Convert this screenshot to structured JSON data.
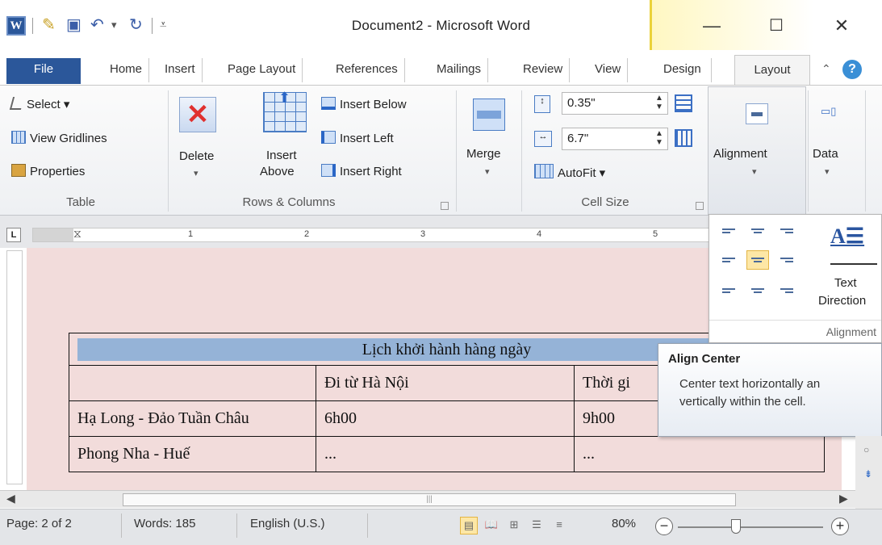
{
  "titlebar": {
    "app_icon_letter": "W",
    "title": "Document2 - Microsoft Word",
    "minimize": "—",
    "maximize": "☐",
    "close": "✕"
  },
  "tabs": {
    "file": "File",
    "home": "Home",
    "insert": "Insert",
    "page_layout": "Page Layout",
    "references": "References",
    "mailings": "Mailings",
    "review": "Review",
    "view": "View",
    "design": "Design",
    "layout": "Layout",
    "help": "?"
  },
  "ribbon": {
    "table_group": {
      "select": "Select ▾",
      "view_gridlines": "View Gridlines",
      "properties": "Properties",
      "label": "Table"
    },
    "rows_columns_group": {
      "delete": "Delete",
      "insert_above_1": "Insert",
      "insert_above_2": "Above",
      "insert_below": "Insert Below",
      "insert_left": "Insert Left",
      "insert_right": "Insert Right",
      "label": "Rows & Columns"
    },
    "merge_group": {
      "merge": "Merge"
    },
    "cell_size_group": {
      "height_value": "0.35\"",
      "width_value": "6.7\"",
      "autofit": "AutoFit ▾",
      "label": "Cell Size"
    },
    "alignment_button": "Alignment",
    "data_button": "Data"
  },
  "ruler": {
    "tab_selector": "L",
    "numbers": [
      "1",
      "2",
      "3",
      "4",
      "5"
    ]
  },
  "alignment_dropdown": {
    "text_direction_1": "Text",
    "text_direction_2": "Direction",
    "footer": "Alignment"
  },
  "tooltip": {
    "title": "Align Center",
    "description_1": "Center text horizontally an",
    "description_2": "vertically within the cell."
  },
  "document_table": {
    "header": "Lịch khởi hành hàng ngày",
    "col_header_1": "",
    "col_header_2": "Đi từ Hà Nội",
    "col_header_3": "Thời gi",
    "rows": [
      {
        "route": "Hạ Long - Đảo Tuần Châu",
        "depart": "6h00",
        "time": "9h00"
      },
      {
        "route": "Phong Nha - Huế",
        "depart": "...",
        "time": "..."
      }
    ]
  },
  "statusbar": {
    "page": "Page: 2 of 2",
    "words": "Words: 185",
    "language": "English (U.S.)",
    "zoom": "80%",
    "zoom_level": 0.4
  }
}
